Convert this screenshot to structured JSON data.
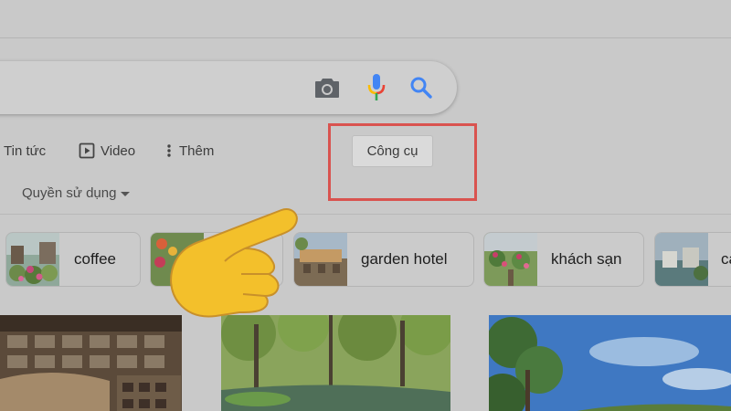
{
  "tabs": {
    "news": "Tin tức",
    "video": "Video",
    "more": "Thêm"
  },
  "tools_button": "Công cụ",
  "filter": {
    "usage_rights": "Quyền sử dụng"
  },
  "chips": [
    {
      "label": "coffee"
    },
    {
      "label": "garden hotel"
    },
    {
      "label": "khách sạn"
    },
    {
      "label": "ca"
    }
  ],
  "icons": {
    "camera": "camera-icon",
    "mic": "mic-icon",
    "search": "search-icon",
    "video": "play-icon",
    "more": "vertical-dots-icon",
    "pointer": "pointing-hand-icon"
  },
  "colors": {
    "highlight": "#d9534f",
    "search_blue": "#4285f4",
    "mic_red": "#ea4335",
    "mic_yellow": "#fbbc05",
    "mic_green": "#34a853",
    "hand_yellow": "#f3c02b"
  }
}
